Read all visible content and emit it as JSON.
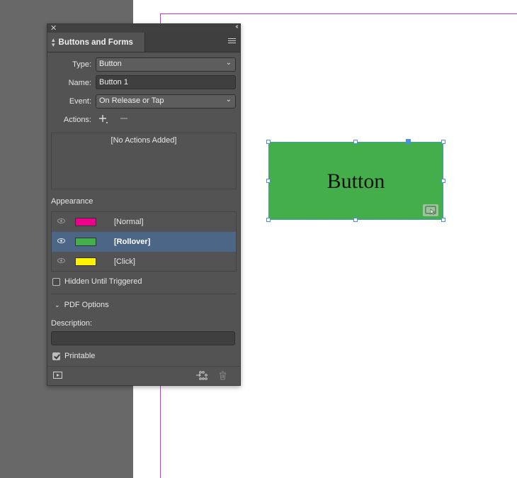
{
  "panel": {
    "title": "Buttons and Forms",
    "type_label": "Type:",
    "type_value": "Button",
    "name_label": "Name:",
    "name_value": "Button 1",
    "event_label": "Event:",
    "event_value": "On Release or Tap",
    "actions_label": "Actions:",
    "actions_empty": "[No Actions Added]",
    "appearance_title": "Appearance",
    "appearance_states": [
      {
        "label": "[Normal]",
        "color": "#ec008c",
        "selected": false
      },
      {
        "label": "[Rollover]",
        "color": "#44ae4b",
        "selected": true
      },
      {
        "label": "[Click]",
        "color": "#fff200",
        "selected": false
      }
    ],
    "hidden_until_triggered_label": "Hidden Until Triggered",
    "hidden_until_triggered_checked": false,
    "pdf_options_label": "PDF Options",
    "description_label": "Description:",
    "description_value": "",
    "printable_label": "Printable",
    "printable_checked": true
  },
  "canvas": {
    "button_text": "Button",
    "button_color": "#44ae4b",
    "margin_color": "#c23bd4",
    "selection_color": "#4a8fe0"
  },
  "icons": {
    "close": "close-icon",
    "collapse": "collapse-icon",
    "menu": "panel-menu-icon",
    "add": "add-action-icon",
    "remove": "remove-action-icon",
    "preview": "preview-icon",
    "convert": "convert-object-icon",
    "delete": "trash-icon"
  }
}
